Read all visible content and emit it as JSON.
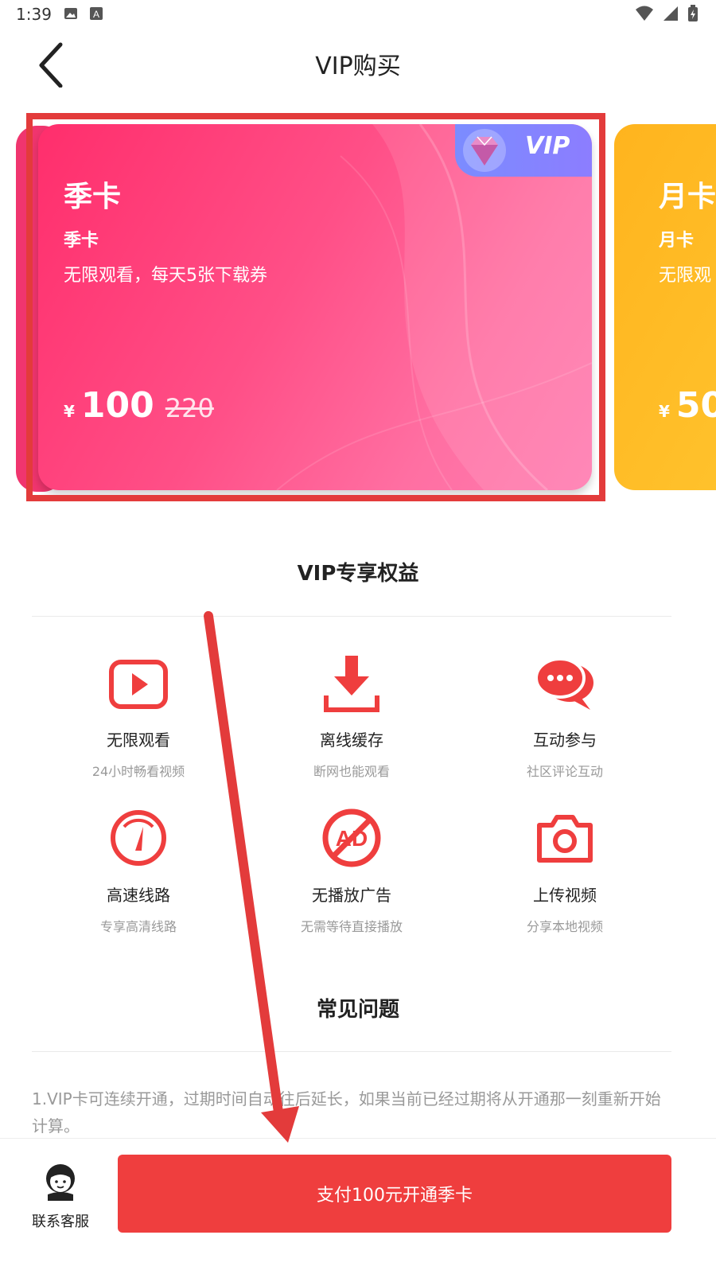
{
  "status_bar": {
    "time": "1:39"
  },
  "header": {
    "title": "VIP购买",
    "back_icon": "chevron-left-icon"
  },
  "cards": {
    "selected": {
      "badge": "VIP",
      "title": "季卡",
      "subtitle": "季卡",
      "description": "无限观看，每天5张下载券",
      "currency": "¥",
      "price": "100",
      "original_price": "220",
      "color": "#ff3f7b"
    },
    "next": {
      "title": "月卡",
      "subtitle": "月卡",
      "description": "无限观",
      "currency": "¥",
      "price": "50",
      "color": "#ffb81f"
    }
  },
  "benefits": {
    "title": "VIP专享权益",
    "items": [
      {
        "icon": "play-icon",
        "title": "无限观看",
        "desc": "24小时畅看视频"
      },
      {
        "icon": "download-icon",
        "title": "离线缓存",
        "desc": "断网也能观看"
      },
      {
        "icon": "chat-icon",
        "title": "互动参与",
        "desc": "社区评论互动"
      },
      {
        "icon": "speedometer-icon",
        "title": "高速线路",
        "desc": "专享高清线路"
      },
      {
        "icon": "no-ad-icon",
        "title": "无播放广告",
        "desc": "无需等待直接播放"
      },
      {
        "icon": "camera-icon",
        "title": "上传视频",
        "desc": "分享本地视频"
      }
    ]
  },
  "faq": {
    "title": "常见问题",
    "item1": "1.VIP卡可连续开通，过期时间自动往后延长，如果当前已经过期将从开通那一刻重新开始计算。"
  },
  "bottom": {
    "service_label": "联系客服",
    "pay_button": "支付100元开通季卡"
  },
  "colors": {
    "accent": "#ef3e3e",
    "annotation": "#e33b3b"
  }
}
